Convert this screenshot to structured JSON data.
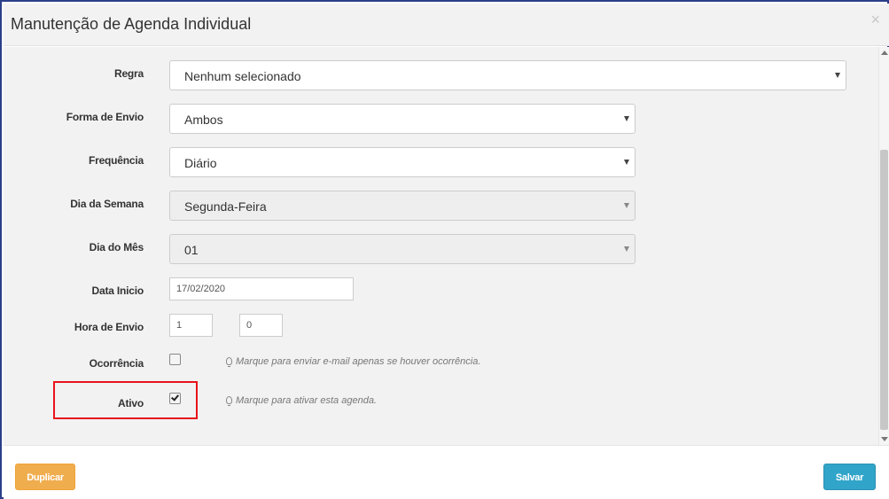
{
  "modal": {
    "title": "Manutenção de Agenda Individual",
    "close_symbol": "×"
  },
  "form": {
    "regra": {
      "label": "Regra",
      "value": "Nenhum selecionado"
    },
    "forma_envio": {
      "label": "Forma de Envio",
      "value": "Ambos"
    },
    "frequencia": {
      "label": "Frequência",
      "value": "Diário"
    },
    "dia_semana": {
      "label": "Dia da Semana",
      "value": "Segunda-Feira"
    },
    "dia_mes": {
      "label": "Dia do Mês",
      "value": "01"
    },
    "data_inicio": {
      "label": "Data Inicio",
      "value": "17/02/2020"
    },
    "hora_envio": {
      "label": "Hora de Envio",
      "hour": "1",
      "minute": "0"
    },
    "ocorrencia": {
      "label": "Ocorrência",
      "checked": false,
      "hint": "Marque para enviar e-mail apenas se houver ocorrência."
    },
    "ativo": {
      "label": "Ativo",
      "checked": true,
      "hint": "Marque para ativar esta agenda."
    }
  },
  "footer": {
    "duplicate_label": "Duplicar",
    "save_label": "Salvar"
  },
  "colors": {
    "duplicate": "#f0ad4e",
    "save": "#31a5c9",
    "highlight": "#e8131b"
  },
  "icons": [
    "close-icon",
    "caret-down-icon",
    "lightbulb-icon",
    "checkmark-icon"
  ]
}
